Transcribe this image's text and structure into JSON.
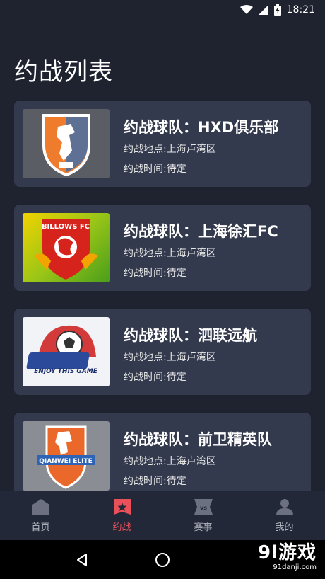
{
  "status_bar": {
    "time": "18:21"
  },
  "page": {
    "title": "约战列表"
  },
  "cards": [
    {
      "title": "约战球队：HXD俱乐部",
      "location": "约战地点:上海卢湾区",
      "time": "约战时间:待定"
    },
    {
      "title": "约战球队：上海徐汇FC",
      "location": "约战地点:上海卢湾区",
      "time": "约战时间:待定",
      "logo_text": "BILLOWS FC"
    },
    {
      "title": "约战球队：泗联远航",
      "location": "约战地点:上海卢湾区",
      "time": "约战时间:待定",
      "logo_text": "ENJOY THIS GAME"
    },
    {
      "title": "约战球队：前卫精英队",
      "location": "约战地点:上海卢湾区",
      "time": "约战时间:待定",
      "logo_text": "QIANWEI ELITE"
    }
  ],
  "tabs": [
    {
      "label": "首页",
      "icon": "home-icon"
    },
    {
      "label": "约战",
      "icon": "star-badge-icon",
      "active": true
    },
    {
      "label": "赛事",
      "icon": "vs-icon"
    },
    {
      "label": "我的",
      "icon": "user-icon"
    }
  ],
  "watermark": {
    "logo": "9l游戏",
    "sub": "91danji.com"
  },
  "colors": {
    "background": "#1f2330",
    "card": "#343a4d",
    "accent": "#e9505a",
    "tab_bar": "#232838"
  }
}
